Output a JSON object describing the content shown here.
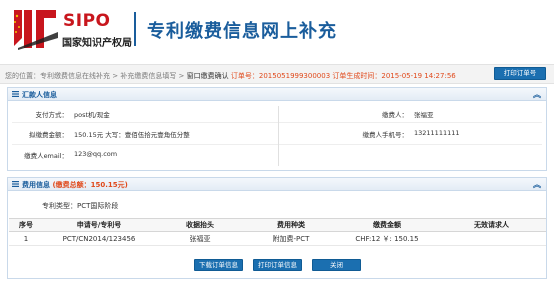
{
  "header": {
    "logo_text": "SIPO",
    "logo_org": "国家知识产权局",
    "title": "专利缴费信息网上补充"
  },
  "breadcrumb": {
    "prefix": "您的位置：",
    "step1": "专利缴费信息在线补充",
    "sep": " > ",
    "step2": "补充缴费信息填写",
    "step3": "窗口缴费确认",
    "order_label": "订单号：",
    "order_no": "2015051999300003",
    "time_label": "订单生成时间：",
    "time": "2015-05-19 14:27:56"
  },
  "buttons": {
    "print_order_top": "打印订单号",
    "download_order": "下载订单信息",
    "print_order": "打印订单信息",
    "close": "关闭"
  },
  "remitter": {
    "section_title": "汇款人信息",
    "pay_method_label": "支付方式：",
    "pay_method": "post机/现金",
    "amount_label": "拟缴费金额：",
    "amount": "150.15元  大写：壹佰伍拾元壹角伍分整",
    "email_label": "缴费人email：",
    "email": "123@qq.com",
    "payer_label": "缴费人：",
    "payer": "张福亚",
    "phone_label": "缴费人手机号：",
    "phone": "13211111111"
  },
  "fees": {
    "section_title": "费用信息",
    "total_text": "(缴费总额：150.15元)",
    "type_label": "专利类型：",
    "type": "PCT国际阶段",
    "columns": [
      "序号",
      "申请号/专利号",
      "收据抬头",
      "费用种类",
      "缴费金额",
      "无效请求人"
    ],
    "rows": [
      [
        "1",
        "PCT/CN2014/123456",
        "张福亚",
        "附加费-PCT",
        "CHF:12  ￥: 150.15",
        ""
      ]
    ]
  },
  "colors": {
    "brand_blue": "#1a5d9c",
    "brand_red": "#c8161d",
    "highlight_orange": "#e0491b",
    "button_blue": "#1b6fb0"
  }
}
